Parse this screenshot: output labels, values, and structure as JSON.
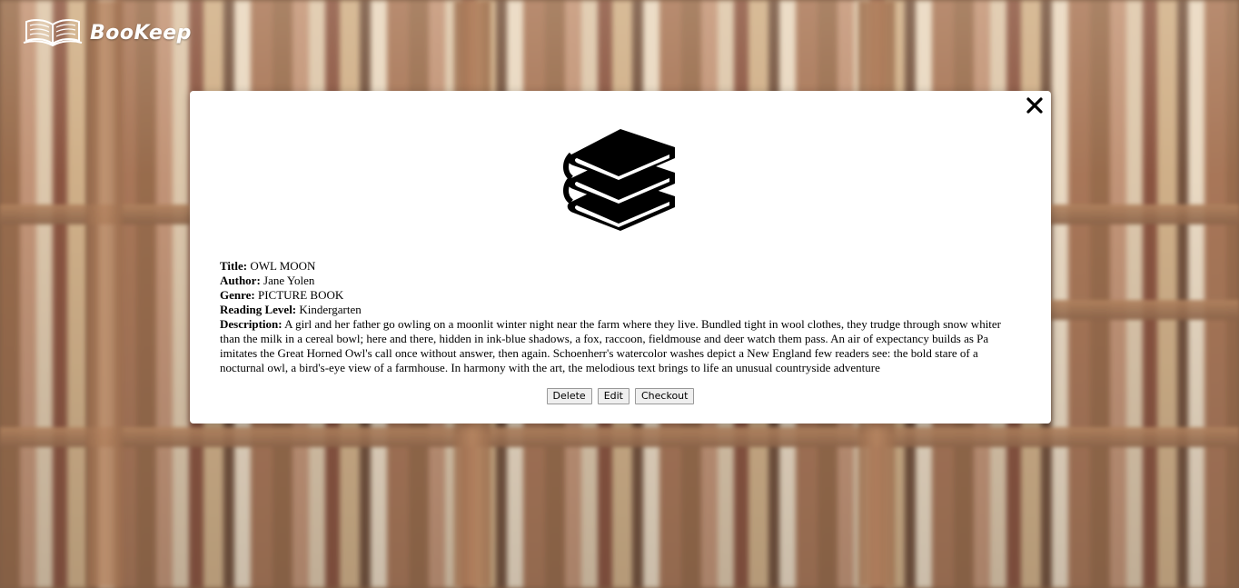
{
  "brand": {
    "name": "BooKeep",
    "logo_icon": "open-book-icon"
  },
  "modal": {
    "close_icon": "close-icon",
    "image_icon": "stack-of-books-icon",
    "fields": {
      "title_label": "Title:",
      "title_value": "OWL MOON",
      "author_label": "Author:",
      "author_value": "Jane Yolen",
      "genre_label": "Genre:",
      "genre_value": "PICTURE BOOK",
      "reading_level_label": "Reading Level:",
      "reading_level_value": "Kindergarten",
      "description_label": "Description:",
      "description_value": "A girl and her father go owling on a moonlit winter night near the farm where they live. Bundled tight in wool clothes, they trudge through snow whiter than the milk in a cereal bowl; here and there, hidden in ink-blue shadows, a fox, raccoon, fieldmouse and deer watch them pass. An air of expectancy builds as Pa imitates the Great Horned Owl's call once without answer, then again. Schoenherr's watercolor washes depict a New England few readers see: the bold stare of a nocturnal owl, a bird's-eye view of a farmhouse. In harmony with the art, the melodious text brings to life an unusual countryside adventure"
    },
    "actions": {
      "delete_label": "Delete",
      "edit_label": "Edit",
      "checkout_label": "Checkout"
    }
  }
}
